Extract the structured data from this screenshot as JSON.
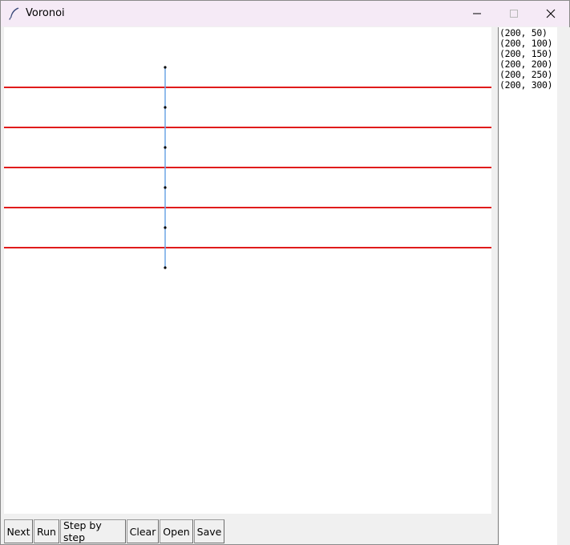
{
  "window": {
    "title": "Voronoi"
  },
  "titlebar_controls": {
    "minimize_icon": "minimize-icon",
    "maximize_icon": "maximize-icon",
    "close_icon": "close-icon"
  },
  "points_list": {
    "items": [
      "(200, 50)",
      "(200, 100)",
      "(200, 150)",
      "(200, 200)",
      "(200, 250)",
      "(200, 300)"
    ]
  },
  "toolbar": {
    "next_label": "Next",
    "run_label": "Run",
    "step_label": "Step by step",
    "clear_label": "Clear",
    "open_label": "Open",
    "save_label": "Save"
  },
  "colors": {
    "voronoi_edge": "#e01b1b",
    "hull_edge": "#6fa5e6",
    "point": "#000000",
    "titlebar_bg": "#f5eaf6"
  }
}
